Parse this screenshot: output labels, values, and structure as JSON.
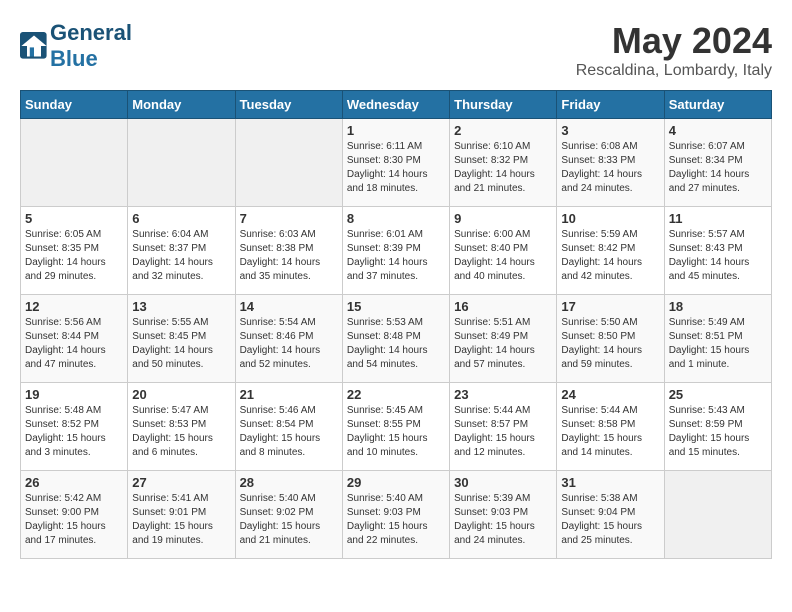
{
  "header": {
    "logo_text_general": "General",
    "logo_text_blue": "Blue",
    "month_title": "May 2024",
    "subtitle": "Rescaldina, Lombardy, Italy"
  },
  "days_of_week": [
    "Sunday",
    "Monday",
    "Tuesday",
    "Wednesday",
    "Thursday",
    "Friday",
    "Saturday"
  ],
  "weeks": [
    [
      {
        "day": "",
        "empty": true
      },
      {
        "day": "",
        "empty": true
      },
      {
        "day": "",
        "empty": true
      },
      {
        "day": "1",
        "sunrise": "6:11 AM",
        "sunset": "8:30 PM",
        "daylight": "14 hours and 18 minutes."
      },
      {
        "day": "2",
        "sunrise": "6:10 AM",
        "sunset": "8:32 PM",
        "daylight": "14 hours and 21 minutes."
      },
      {
        "day": "3",
        "sunrise": "6:08 AM",
        "sunset": "8:33 PM",
        "daylight": "14 hours and 24 minutes."
      },
      {
        "day": "4",
        "sunrise": "6:07 AM",
        "sunset": "8:34 PM",
        "daylight": "14 hours and 27 minutes."
      }
    ],
    [
      {
        "day": "5",
        "sunrise": "6:05 AM",
        "sunset": "8:35 PM",
        "daylight": "14 hours and 29 minutes."
      },
      {
        "day": "6",
        "sunrise": "6:04 AM",
        "sunset": "8:37 PM",
        "daylight": "14 hours and 32 minutes."
      },
      {
        "day": "7",
        "sunrise": "6:03 AM",
        "sunset": "8:38 PM",
        "daylight": "14 hours and 35 minutes."
      },
      {
        "day": "8",
        "sunrise": "6:01 AM",
        "sunset": "8:39 PM",
        "daylight": "14 hours and 37 minutes."
      },
      {
        "day": "9",
        "sunrise": "6:00 AM",
        "sunset": "8:40 PM",
        "daylight": "14 hours and 40 minutes."
      },
      {
        "day": "10",
        "sunrise": "5:59 AM",
        "sunset": "8:42 PM",
        "daylight": "14 hours and 42 minutes."
      },
      {
        "day": "11",
        "sunrise": "5:57 AM",
        "sunset": "8:43 PM",
        "daylight": "14 hours and 45 minutes."
      }
    ],
    [
      {
        "day": "12",
        "sunrise": "5:56 AM",
        "sunset": "8:44 PM",
        "daylight": "14 hours and 47 minutes."
      },
      {
        "day": "13",
        "sunrise": "5:55 AM",
        "sunset": "8:45 PM",
        "daylight": "14 hours and 50 minutes."
      },
      {
        "day": "14",
        "sunrise": "5:54 AM",
        "sunset": "8:46 PM",
        "daylight": "14 hours and 52 minutes."
      },
      {
        "day": "15",
        "sunrise": "5:53 AM",
        "sunset": "8:48 PM",
        "daylight": "14 hours and 54 minutes."
      },
      {
        "day": "16",
        "sunrise": "5:51 AM",
        "sunset": "8:49 PM",
        "daylight": "14 hours and 57 minutes."
      },
      {
        "day": "17",
        "sunrise": "5:50 AM",
        "sunset": "8:50 PM",
        "daylight": "14 hours and 59 minutes."
      },
      {
        "day": "18",
        "sunrise": "5:49 AM",
        "sunset": "8:51 PM",
        "daylight": "15 hours and 1 minute."
      }
    ],
    [
      {
        "day": "19",
        "sunrise": "5:48 AM",
        "sunset": "8:52 PM",
        "daylight": "15 hours and 3 minutes."
      },
      {
        "day": "20",
        "sunrise": "5:47 AM",
        "sunset": "8:53 PM",
        "daylight": "15 hours and 6 minutes."
      },
      {
        "day": "21",
        "sunrise": "5:46 AM",
        "sunset": "8:54 PM",
        "daylight": "15 hours and 8 minutes."
      },
      {
        "day": "22",
        "sunrise": "5:45 AM",
        "sunset": "8:55 PM",
        "daylight": "15 hours and 10 minutes."
      },
      {
        "day": "23",
        "sunrise": "5:44 AM",
        "sunset": "8:57 PM",
        "daylight": "15 hours and 12 minutes."
      },
      {
        "day": "24",
        "sunrise": "5:44 AM",
        "sunset": "8:58 PM",
        "daylight": "15 hours and 14 minutes."
      },
      {
        "day": "25",
        "sunrise": "5:43 AM",
        "sunset": "8:59 PM",
        "daylight": "15 hours and 15 minutes."
      }
    ],
    [
      {
        "day": "26",
        "sunrise": "5:42 AM",
        "sunset": "9:00 PM",
        "daylight": "15 hours and 17 minutes."
      },
      {
        "day": "27",
        "sunrise": "5:41 AM",
        "sunset": "9:01 PM",
        "daylight": "15 hours and 19 minutes."
      },
      {
        "day": "28",
        "sunrise": "5:40 AM",
        "sunset": "9:02 PM",
        "daylight": "15 hours and 21 minutes."
      },
      {
        "day": "29",
        "sunrise": "5:40 AM",
        "sunset": "9:03 PM",
        "daylight": "15 hours and 22 minutes."
      },
      {
        "day": "30",
        "sunrise": "5:39 AM",
        "sunset": "9:03 PM",
        "daylight": "15 hours and 24 minutes."
      },
      {
        "day": "31",
        "sunrise": "5:38 AM",
        "sunset": "9:04 PM",
        "daylight": "15 hours and 25 minutes."
      },
      {
        "day": "",
        "empty": true
      }
    ]
  ],
  "labels": {
    "sunrise": "Sunrise:",
    "sunset": "Sunset:",
    "daylight": "Daylight:"
  }
}
